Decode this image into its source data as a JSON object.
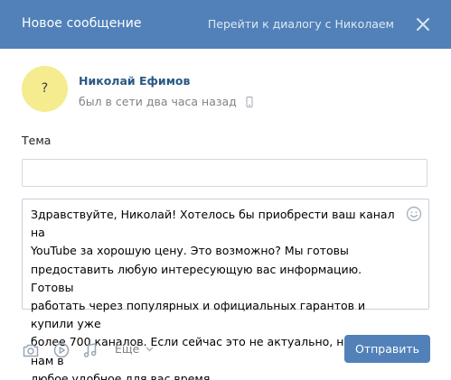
{
  "header": {
    "title": "Новое сообщение",
    "dialog_link": "Перейти к диалогу с Николаем"
  },
  "recipient": {
    "avatar_char": "?",
    "name": "Николай Ефимов",
    "status": "был в сети два часа назад"
  },
  "form": {
    "subject_label": "Тема",
    "subject_value": "",
    "message_value": "Здравствуйте, Николай! Хотелось бы приобрести ваш канал на\nYouTube за хорошую цену. Это возможно? Мы готовы\nпредоставить любую интересующую вас информацию. Готовы\nработать через популярных и официальных гарантов и купили уже\nболее 700 каналов. Если сейчас это не актуально, напишите нам в\nлюбое удобное для вас время."
  },
  "toolbar": {
    "more_label": "Ещё",
    "send_label": "Отправить"
  },
  "colors": {
    "header_bg": "#5181b8",
    "avatar_bg": "#f4ec8e",
    "link": "#2a5885",
    "muted": "#828282"
  }
}
